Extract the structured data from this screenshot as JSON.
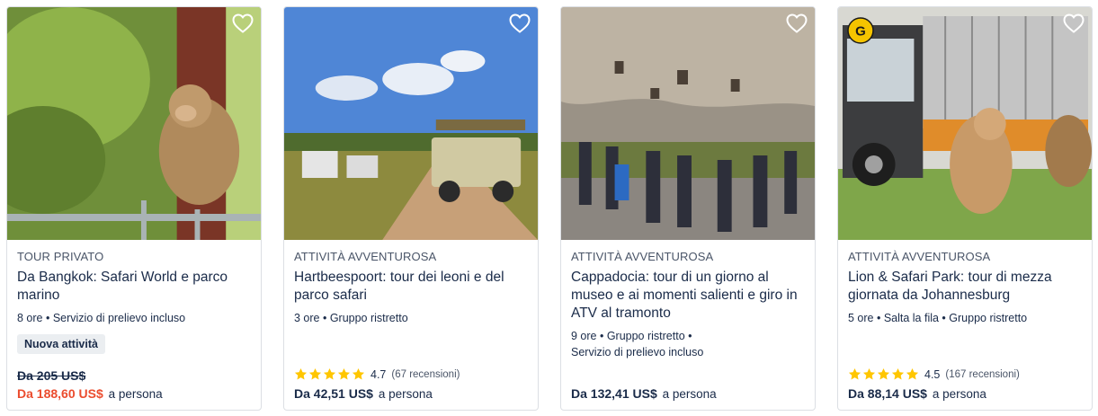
{
  "cards": [
    {
      "category": "TOUR PRIVATO",
      "title": "Da Bangkok: Safari World e parco marino",
      "meta": "8 ore • Servizio di prelievo incluso",
      "tag": "Nuova attività",
      "old_price": "Da 205 US$",
      "price": "Da 188,60 US$",
      "per": "a persona"
    },
    {
      "category": "ATTIVITÀ AVVENTUROSA",
      "title": "Hartbeespoort: tour dei leoni e del parco safari",
      "meta": "3 ore • Gruppo ristretto",
      "rating": "4.7",
      "rating_count": "(67 recensioni)",
      "price": "Da 42,51 US$",
      "per": "a persona"
    },
    {
      "category": "ATTIVITÀ AVVENTUROSA",
      "title": "Cappadocia: tour di un giorno al museo e ai momenti salienti e giro in ATV al tramonto",
      "meta": "9 ore • Gruppo ristretto • Servizio di prelievo incluso",
      "price": "Da 132,41 US$",
      "per": "a persona"
    },
    {
      "category": "ATTIVITÀ AVVENTUROSA",
      "title": "Lion & Safari Park: tour di mezza giornata da Johannesburg",
      "meta": "5 ore • Salta la fila • Gruppo ristretto",
      "rating": "4.5",
      "rating_count": "(167 recensioni)",
      "price": "Da 88,14 US$",
      "per": "a persona",
      "badge": "G"
    }
  ],
  "colors": {
    "sale": "#eb4c2e",
    "star": "#ffc600",
    "text": "#1a2b49",
    "badge": "#f5c400"
  },
  "icons": {
    "wishlist": "heart-outline-icon",
    "rating": "star-icon",
    "badge": "gyg-badge-icon"
  }
}
